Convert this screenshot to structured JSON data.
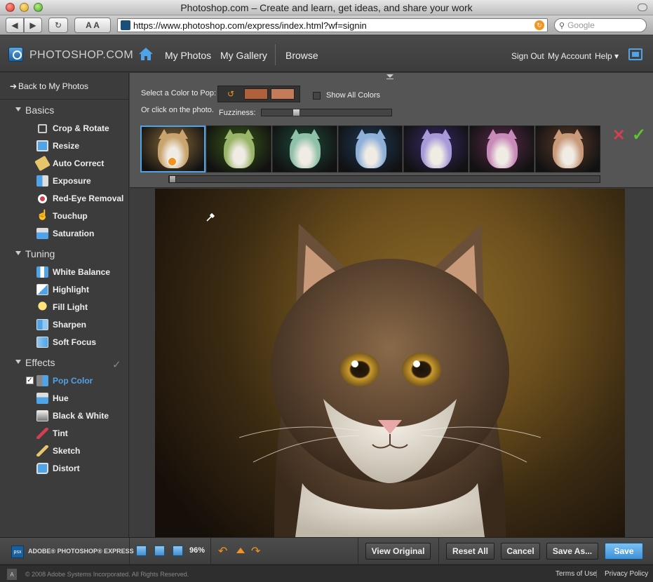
{
  "window": {
    "title": "Photoshop.com – Create and learn, get ideas, and share your work"
  },
  "browser": {
    "url": "https://www.photoshop.com/express/index.html?wf=signin",
    "search_placeholder": "Google",
    "text_size_label": "A A"
  },
  "header": {
    "brand": "PHOTOSHOP.COM",
    "nav": [
      "My Photos",
      "My Gallery",
      "Browse"
    ],
    "right_nav": [
      "Sign Out",
      "My Account",
      "Help ▾"
    ]
  },
  "sidebar": {
    "back_label": "Back to My Photos",
    "sections": [
      {
        "title": "Basics",
        "items": [
          "Crop & Rotate",
          "Resize",
          "Auto Correct",
          "Exposure",
          "Red-Eye Removal",
          "Touchup",
          "Saturation"
        ]
      },
      {
        "title": "Tuning",
        "items": [
          "White Balance",
          "Highlight",
          "Fill Light",
          "Sharpen",
          "Soft Focus"
        ]
      },
      {
        "title": "Effects",
        "items": [
          "Pop Color",
          "Hue",
          "Black & White",
          "Tint",
          "Sketch",
          "Distort"
        ]
      }
    ],
    "active_item": "Pop Color"
  },
  "panel": {
    "select_label": "Select a Color to Pop:",
    "click_label": "Or click on the photo.",
    "show_all_label": "Show All Colors",
    "show_all_checked": false,
    "fuzziness_label": "Fuzziness:",
    "fuzziness_value": 0.25,
    "swatch_colors": [
      "#b0603a",
      "#c47b5a"
    ],
    "selected_thumb": 0,
    "thumbs": [
      {
        "tint": "#8a6a3a",
        "face": "#c9a46e"
      },
      {
        "tint": "#3a5a1a",
        "face": "#9ab56a"
      },
      {
        "tint": "#1f4a3a",
        "face": "#8fc0a8"
      },
      {
        "tint": "#1f3a5a",
        "face": "#8fb0d8"
      },
      {
        "tint": "#3a2a6a",
        "face": "#a89ad8"
      },
      {
        "tint": "#5a2a4a",
        "face": "#c88ab8"
      },
      {
        "tint": "#5a3a2a",
        "face": "#c89a7a"
      }
    ]
  },
  "bottom": {
    "adobe_brand": "ADOBE® PHOTOSHOP® EXPRESS",
    "zoom": "96%",
    "buttons": [
      "View Original",
      "Reset All",
      "Cancel",
      "Save As...",
      "Save"
    ]
  },
  "footer": {
    "copyright": "© 2008 Adobe Systems Incorporated. All Rights Reserved.",
    "terms": "Terms of Use",
    "privacy": "Privacy Policy"
  },
  "colors": {
    "accent": "#4fa3e6",
    "orange": "#f39420",
    "cancel": "#d23f52",
    "accept": "#5fc42f"
  }
}
